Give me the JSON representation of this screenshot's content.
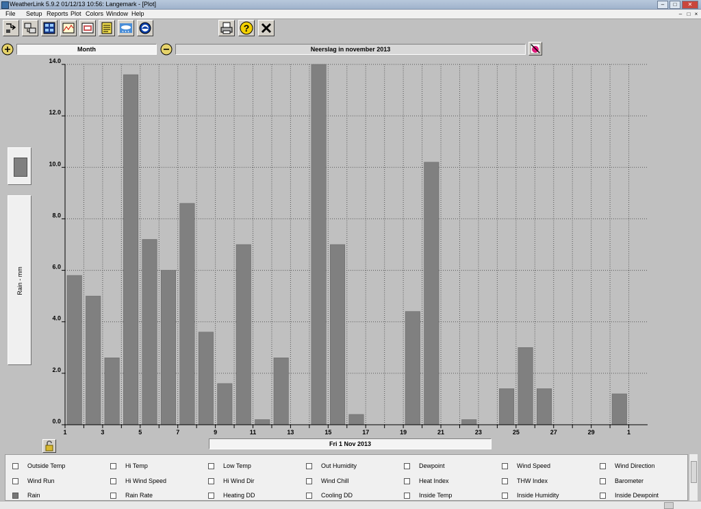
{
  "window": {
    "title": "WeatherLink 5.9.2  01/12/13  10:56: Langemark - [Plot]",
    "minimize_glyph": "–",
    "maximize_glyph": "□",
    "close_glyph": "✕"
  },
  "menu": {
    "items": [
      "File",
      "Setup",
      "Reports",
      "Plot",
      "Colors",
      "Window",
      "Help"
    ],
    "mdi_buttons": [
      "–",
      "□",
      "×"
    ]
  },
  "toolbar": {
    "buttons": [
      "select-station-icon",
      "download-icon",
      "bulletin-icon",
      "strip-charts-icon",
      "browse-icon",
      "notes-icon",
      "online-weather-icon",
      "noaa-icon"
    ],
    "right_buttons": [
      "print-icon",
      "help-icon",
      "close-icon"
    ]
  },
  "controls": {
    "period": "Month",
    "plot_title": "Neerslag in november 2013",
    "zoom_in_icon": "zoom-in-icon",
    "zoom_out_icon": "zoom-out-icon",
    "color_picker_icon": "color-picker-icon"
  },
  "axis": {
    "y_label": "Rain - mm",
    "date": "Fri 1 Nov 2013"
  },
  "chart_data": {
    "type": "bar",
    "title": "Neerslag in november 2013",
    "ylabel": "Rain - mm",
    "xlabel": "Fri 1 Nov 2013",
    "ylim": [
      0,
      14
    ],
    "y_ticks": [
      "0.0",
      "2.0",
      "4.0",
      "6.0",
      "8.0",
      "10.0",
      "12.0",
      "14.0"
    ],
    "x_ticks": [
      "1",
      "3",
      "5",
      "7",
      "9",
      "11",
      "13",
      "15",
      "17",
      "19",
      "21",
      "23",
      "25",
      "27",
      "29",
      "1"
    ],
    "grid": true,
    "bar_color": "#808080",
    "categories": [
      "1",
      "2",
      "3",
      "4",
      "5",
      "6",
      "7",
      "8",
      "9",
      "10",
      "11",
      "12",
      "13",
      "14",
      "15",
      "16",
      "17",
      "18",
      "19",
      "20",
      "21",
      "22",
      "23",
      "24",
      "25",
      "26",
      "27",
      "28",
      "29",
      "30"
    ],
    "values": [
      5.8,
      5.0,
      2.6,
      13.6,
      7.2,
      6.0,
      8.6,
      3.6,
      1.6,
      7.0,
      0.2,
      2.6,
      0,
      14.0,
      7.0,
      0.4,
      0,
      0,
      4.4,
      10.2,
      0,
      0.2,
      0,
      1.4,
      3.0,
      1.4,
      0,
      0,
      0,
      1.2
    ]
  },
  "checkboxes": [
    {
      "label": "Outside Temp",
      "checked": false
    },
    {
      "label": "Hi Temp",
      "checked": false
    },
    {
      "label": "Low Temp",
      "checked": false
    },
    {
      "label": "Out Humidity",
      "checked": false
    },
    {
      "label": "Dewpoint",
      "checked": false
    },
    {
      "label": "Wind Speed",
      "checked": false
    },
    {
      "label": "Wind Direction",
      "checked": false
    },
    {
      "label": "Wind Run",
      "checked": false
    },
    {
      "label": "Hi Wind Speed",
      "checked": false
    },
    {
      "label": "Hi Wind Dir",
      "checked": false
    },
    {
      "label": "Wind Chill",
      "checked": false
    },
    {
      "label": "Heat Index",
      "checked": false
    },
    {
      "label": "THW Index",
      "checked": false
    },
    {
      "label": "Barometer",
      "checked": false
    },
    {
      "label": "Rain",
      "checked": true
    },
    {
      "label": "Rain Rate",
      "checked": false
    },
    {
      "label": "Heating DD",
      "checked": false
    },
    {
      "label": "Cooling DD",
      "checked": false
    },
    {
      "label": "Inside Temp",
      "checked": false
    },
    {
      "label": "Inside Humidity",
      "checked": false
    },
    {
      "label": "Inside Dewpoint",
      "checked": false
    }
  ]
}
